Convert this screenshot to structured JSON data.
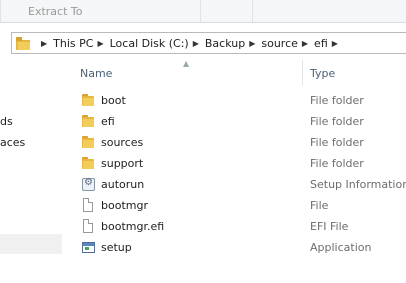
{
  "ribbon": {
    "extract_label": "Extract To"
  },
  "address": {
    "crumbs": [
      "This PC",
      "Local Disk (C:)",
      "Backup",
      "source",
      "efi"
    ]
  },
  "nav": {
    "items": [
      "ds",
      "aces"
    ]
  },
  "columns": {
    "name": "Name",
    "type": "Type"
  },
  "files": [
    {
      "name": "boot",
      "type": "File folder",
      "icon": "folder-icon"
    },
    {
      "name": "efi",
      "type": "File folder",
      "icon": "folder-icon"
    },
    {
      "name": "sources",
      "type": "File folder",
      "icon": "folder-icon"
    },
    {
      "name": "support",
      "type": "File folder",
      "icon": "folder-icon"
    },
    {
      "name": "autorun",
      "type": "Setup Information",
      "icon": "setup-info-icon"
    },
    {
      "name": "bootmgr",
      "type": "File",
      "icon": "file-icon"
    },
    {
      "name": "bootmgr.efi",
      "type": "EFI File",
      "icon": "file-icon"
    },
    {
      "name": "setup",
      "type": "Application",
      "icon": "application-icon"
    }
  ]
}
